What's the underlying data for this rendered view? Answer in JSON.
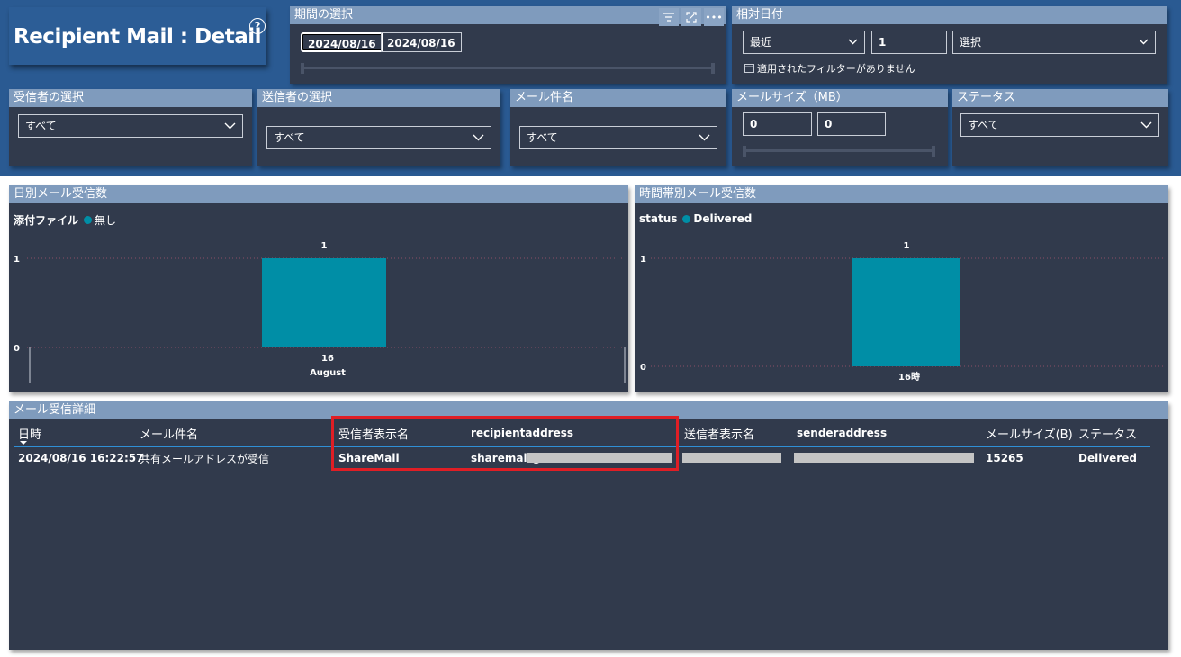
{
  "title": {
    "text": "Recipient Mail : Detail",
    "help_icon": "question-circle-icon"
  },
  "period": {
    "header": "期間の選択",
    "start_date": "2024/08/16",
    "end_date": "2024/08/16",
    "toolbar_icons": [
      "filter-icon",
      "focus-mode-icon",
      "more-options-icon"
    ]
  },
  "relative_date": {
    "header": "相対日付",
    "mode": "最近",
    "count": "1",
    "unit": "選択",
    "notice": "適用されたフィルターがありません"
  },
  "filters": {
    "recipient": {
      "header": "受信者の選択",
      "value": "すべて"
    },
    "sender": {
      "header": "送信者の選択",
      "value": "すべて"
    },
    "subject": {
      "header": "メール件名",
      "value": "すべて"
    },
    "size": {
      "header": "メールサイズ（MB）",
      "min": "0",
      "max": "0"
    },
    "status": {
      "header": "ステータス",
      "value": "すべて"
    }
  },
  "charts": {
    "daily": {
      "header": "日別メール受信数",
      "legend_title": "添付ファイル",
      "legend_item": "無し",
      "x_tick": "16",
      "x_tick2": "August",
      "y_ticks": [
        "1",
        "0"
      ],
      "bar_label": "1"
    },
    "hourly": {
      "header": "時間帯別メール受信数",
      "legend_title": "status",
      "legend_item": "Delivered",
      "x_tick": "16時",
      "y_ticks": [
        "1",
        "0"
      ],
      "bar_label": "1"
    }
  },
  "chart_data": [
    {
      "type": "bar",
      "title": "日別メール受信数",
      "categories": [
        "16 August"
      ],
      "series": [
        {
          "name": "無し",
          "values": [
            1
          ]
        }
      ],
      "legend_title": "添付ファイル",
      "ylim": [
        0,
        1
      ],
      "grid": true,
      "legend_position": "top-left",
      "color": "#008ea6"
    },
    {
      "type": "bar",
      "title": "時間帯別メール受信数",
      "categories": [
        "16時"
      ],
      "series": [
        {
          "name": "Delivered",
          "values": [
            1
          ]
        }
      ],
      "legend_title": "status",
      "ylim": [
        0,
        1
      ],
      "grid": true,
      "legend_position": "top-left",
      "color": "#008ea6"
    }
  ],
  "table": {
    "header": "メール受信詳細",
    "columns": [
      "日時",
      "メール件名",
      "受信者表示名",
      "recipientaddress",
      "送信者表示名",
      "senderaddress",
      "メールサイズ(B)",
      "ステータス"
    ],
    "rows": [
      {
        "datetime": "2024/08/16 16:22:57",
        "subject": "共有メールアドレスが受信",
        "recipient_name": "ShareMail",
        "recipient_address": "sharemail@",
        "sender_name": "",
        "sender_address": "",
        "size": "15265",
        "status": "Delivered"
      }
    ]
  },
  "colors": {
    "band": "#2a5a92",
    "panel": "#313a4c",
    "panel_header": "#7f9bbd",
    "bar": "#008ea6",
    "highlight": "#e01e25"
  }
}
